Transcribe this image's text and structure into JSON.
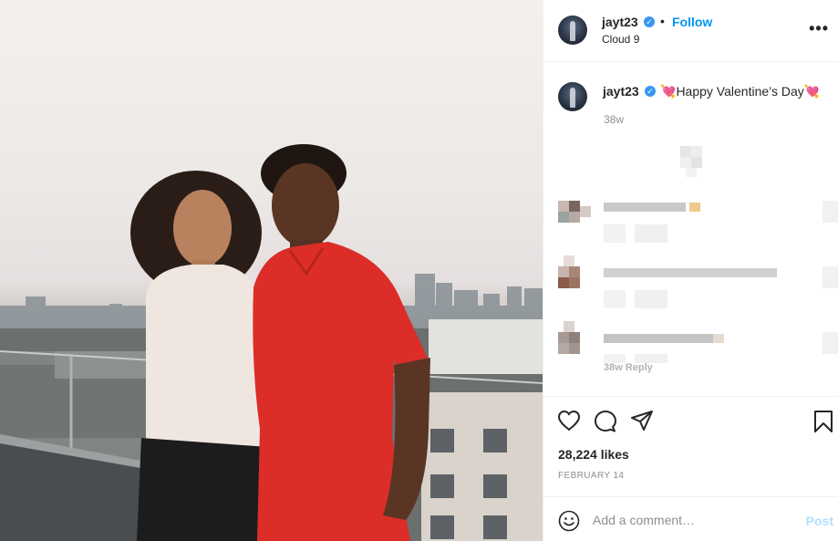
{
  "post": {
    "photo_alt": "",
    "header": {
      "username": "jayt23",
      "verified_mark": "✓",
      "separator": "•",
      "follow_label": "Follow",
      "location": "Cloud 9",
      "more_label": "•••"
    },
    "caption": {
      "username": "jayt23",
      "verified_mark": "✓",
      "emoji_left": "💘",
      "text": "Happy Valentine’s Day",
      "emoji_right": "💘",
      "time": "38w"
    },
    "faded_comment_meta": "38w   Reply",
    "actions": {
      "like_icon": "heart-icon",
      "comment_icon": "comment-bubble-icon",
      "share_icon": "paper-plane-icon",
      "save_icon": "bookmark-icon"
    },
    "likes": "28,224 likes",
    "date": "FEBRUARY 14",
    "add_comment": {
      "emoji_icon": "smiley-icon",
      "placeholder": "Add a comment…",
      "post_label": "Post"
    }
  },
  "colors": {
    "link": "#0095f6",
    "verified": "#3897f0",
    "muted": "#8e8e8e",
    "post_disabled": "#b2dffc"
  }
}
